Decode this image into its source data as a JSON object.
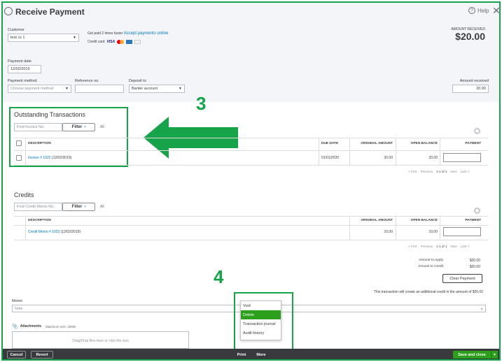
{
  "header": {
    "title": "Receive Payment",
    "help_label": "Help",
    "help_glyph": "?",
    "close_glyph": "✕"
  },
  "customer": {
    "label": "Customer",
    "value": "test cx 1"
  },
  "promo": {
    "text": "Get paid 2 times faster",
    "link": "Accept payments online",
    "credit_card_label": "Credit card"
  },
  "amount_received_top": {
    "label": "AMOUNT RECEIVED",
    "value": "$20.00"
  },
  "payment_date": {
    "label": "Payment date",
    "value": "12/02/2019"
  },
  "payment_method": {
    "label": "Payment method",
    "placeholder": "Choose payment method"
  },
  "reference_no": {
    "label": "Reference no.",
    "value": ""
  },
  "deposit_to": {
    "label": "Deposit to",
    "value": "Banter account"
  },
  "amount_received_field": {
    "label": "Amount received",
    "value": "20.00"
  },
  "outstanding": {
    "title": "Outstanding Transactions",
    "find_placeholder": "Find Invoice No.",
    "filter_label": "Filter",
    "all_label": "All",
    "columns": {
      "description": "DESCRIPTION",
      "due_date": "DUE DATE",
      "original_amount": "ORIGINAL AMOUNT",
      "open_balance": "OPEN BALANCE",
      "payment": "PAYMENT"
    },
    "rows": [
      {
        "invoice_link": "Invoice # 1022",
        "invoice_date": "(12/02/2019)",
        "due_date": "01/01/2020",
        "original_amount": "20.00",
        "open_balance": "20.00"
      }
    ],
    "pager": {
      "first": "< First",
      "previous": "Previous",
      "range": "1-1 of 1",
      "next": "Next",
      "last": "Last >"
    }
  },
  "credits": {
    "title": "Credits",
    "find_placeholder": "Find Credit Memo No.",
    "filter_label": "Filter",
    "all_label": "All",
    "columns": {
      "description": "DESCRIPTION",
      "original_amount": "ORIGINAL AMOUNT",
      "open_balance": "OPEN BALANCE",
      "payment": "PAYMENT"
    },
    "rows": [
      {
        "memo_link": "Credit Memo # 1023",
        "memo_date": "(12/02/2019)",
        "original_amount": "10.00",
        "open_balance": "10.00"
      }
    ],
    "pager": {
      "first": "< First",
      "previous": "Previous",
      "range": "1-1 of 1",
      "next": "Next",
      "last": "Last >"
    }
  },
  "totals": {
    "apply_label": "Amount to Apply",
    "apply_value": "$20.00",
    "credit_label": "Amount to Credit",
    "credit_value": "$20.00",
    "clear_payment_label": "Clear Payment",
    "notice": "This transaction will create an additional credit in the amount of $20.00"
  },
  "memo": {
    "label": "Memo",
    "placeholder": "Note"
  },
  "attachments": {
    "label": "Attachments",
    "max_size": "Maximum size: 25MB",
    "dropzone_text": "Drag/Drop files here or click the icon"
  },
  "annotations": {
    "step3": "3",
    "step4": "4"
  },
  "more_menu": {
    "items": [
      "Void",
      "Delete",
      "Transaction journal",
      "Audit history"
    ],
    "active_index": 1
  },
  "footer": {
    "cancel": "Cancel",
    "revert": "Revert",
    "print": "Print",
    "more": "More",
    "save_close": "Save and close"
  },
  "colors": {
    "annotation_green": "#16a34a",
    "qb_green": "#2ca01c",
    "link_blue": "#0077c5",
    "footer_dark": "#393a3d"
  }
}
